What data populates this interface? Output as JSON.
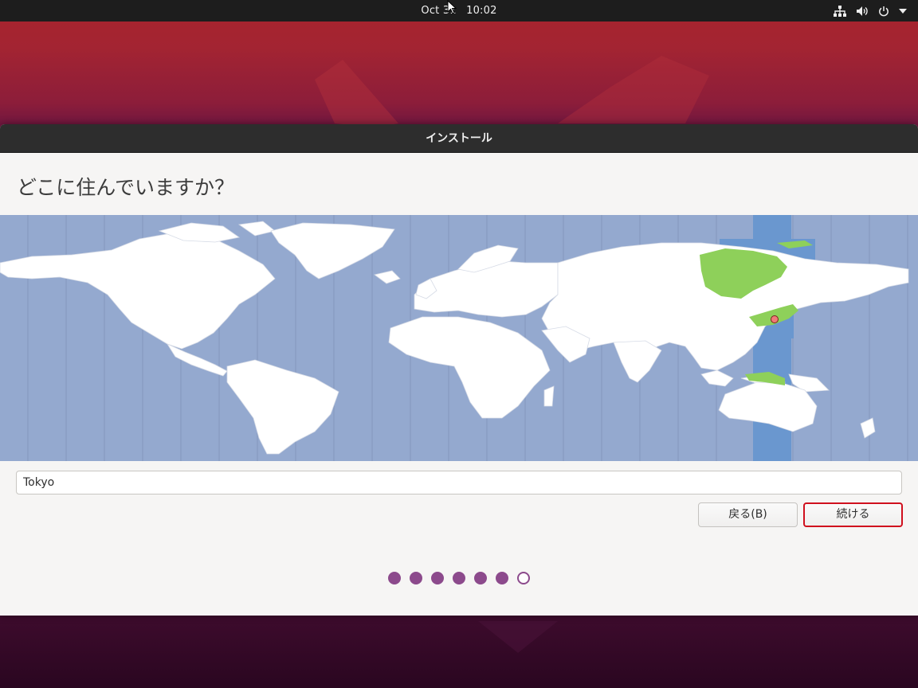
{
  "topbar": {
    "date": "Oct 31",
    "time": "10:02",
    "icons": [
      "network-icon",
      "volume-icon",
      "power-icon",
      "chevron-down-icon"
    ]
  },
  "window": {
    "title": "インストール",
    "heading": "どこに住んでいますか？",
    "timezone_input": {
      "value": "Tokyo"
    },
    "buttons": {
      "back_label": "戻る(B)",
      "continue_label": "続ける"
    },
    "progress": {
      "total_steps": 7,
      "completed_steps": 6
    },
    "map": {
      "ocean_color": "#94a9cf",
      "land_color": "#ffffff",
      "selected_zone_color": "#6a97cf",
      "highlight_color": "#8ed05a",
      "marker_color": "#f07a78",
      "selected_city": "Tokyo"
    }
  },
  "colors": {
    "accent_purple": "#8c4a8c",
    "focus_red": "#d0101e",
    "topbar_bg": "#1d1d1d",
    "titlebar_bg": "#2d2d2d"
  }
}
